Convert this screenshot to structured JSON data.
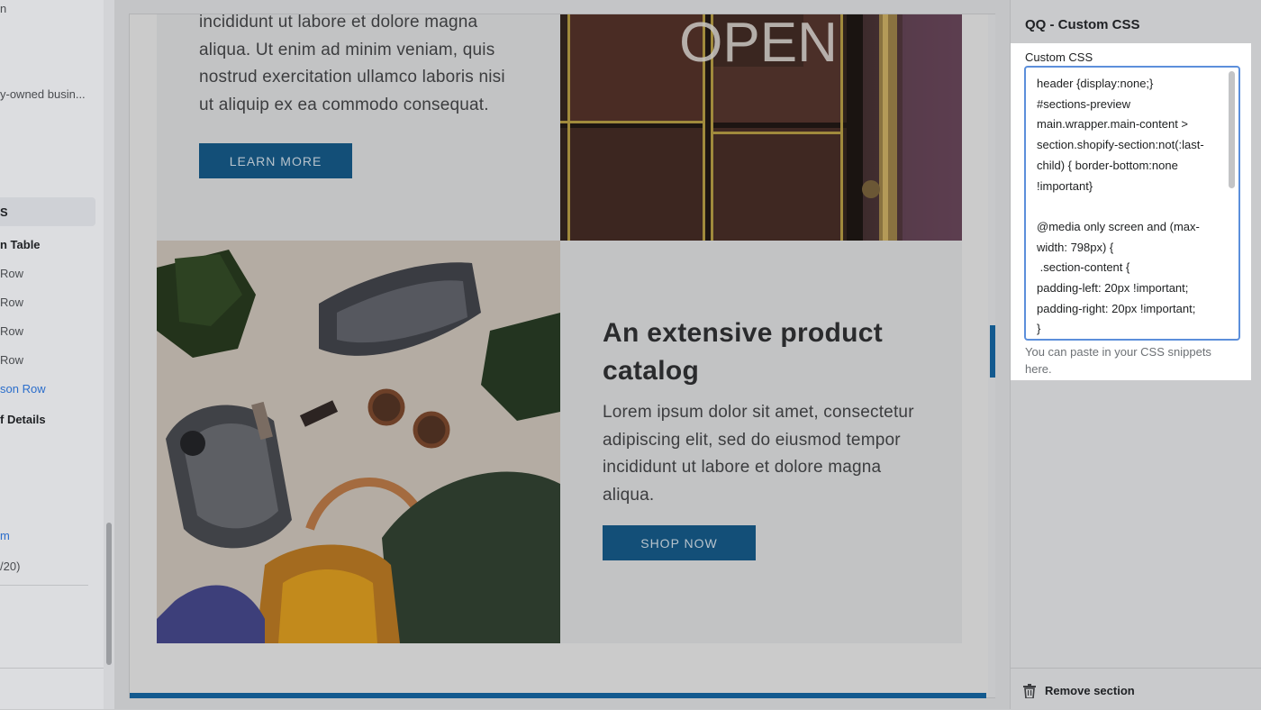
{
  "sidebar": {
    "items": [
      {
        "label": "n",
        "style": "normal"
      },
      {
        "label": "y-owned busin...",
        "style": "normal"
      },
      {
        "label": "S",
        "style": "bold-active"
      },
      {
        "label": "n Table",
        "style": "bold"
      },
      {
        "label": "Row",
        "style": "normal"
      },
      {
        "label": "Row",
        "style": "normal"
      },
      {
        "label": "Row",
        "style": "normal"
      },
      {
        "label": "Row",
        "style": "normal"
      },
      {
        "label": "son Row",
        "style": "link"
      },
      {
        "label": "f Details",
        "style": "bold"
      },
      {
        "label": "m",
        "style": "link"
      },
      {
        "label": "/20)",
        "style": "normal"
      }
    ]
  },
  "preview": {
    "top_paragraph": "incididunt ut labore et dolore magna aliqua. Ut enim ad minim veniam, quis nostrud exercitation ullamco laboris nisi ut aliquip ex ea commodo consequat.",
    "learn_more_label": "LEARN MORE",
    "door_sign": "OPEN",
    "heading": "An extensive product catalog",
    "body_paragraph": "Lorem ipsum dolor sit amet, consectetur adipiscing elit, sed do eiusmod tempor incididunt ut labore et dolore magna aliqua.",
    "shop_now_label": "SHOP NOW"
  },
  "panel": {
    "title": "QQ - Custom CSS",
    "field_label": "Custom CSS",
    "css_value": "header {display:none;}\n#sections-preview main.wrapper.main-content > section.shopify-section:not(:last-child) { border-bottom:none !important}\n\n@media only screen and (max-width: 798px) {\n .section-content {\npadding-left: 20px !important;\npadding-right: 20px !important;\n}",
    "help_text": "You can paste in your CSS snippets here.",
    "remove_label": "Remove section"
  },
  "icons": {
    "remove": "trash-icon"
  },
  "colors": {
    "accent": "#135a8f",
    "button_bg": "#134f78",
    "focus_border": "#5c8fdb",
    "link": "#2c6ecb"
  }
}
